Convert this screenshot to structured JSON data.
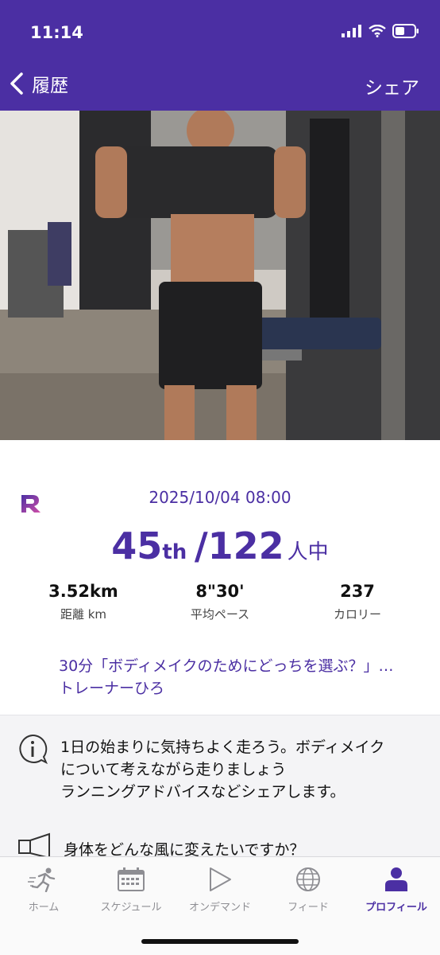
{
  "status": {
    "time": "11:14"
  },
  "nav": {
    "back_label": "履歴",
    "share_label": "シェア"
  },
  "photo": {
    "description_icon": "runner-photo"
  },
  "session": {
    "date": "2025/10/04 08:00",
    "rank": "45",
    "rank_suffix": "th",
    "total": "/122",
    "total_unit": "人中",
    "stats": [
      {
        "value": "3.52km",
        "label": "距離 km"
      },
      {
        "value": "8\"30'",
        "label": "平均ペース"
      },
      {
        "value": "237",
        "label": "カロリー"
      }
    ],
    "program_line1": "30分「ボディメイクのためにどっちを選ぶ？」…",
    "program_line2": "トレーナーひろ"
  },
  "description": {
    "line1": "1日の始まりに気持ちよく走ろう。ボディメイク",
    "line2": "について考えながら走りましょう",
    "line3": "ランニングアドバイスなどシェアします。",
    "question": "身体をどんな風に変えたいですか？"
  },
  "tabs": [
    {
      "label": "ホーム",
      "icon": "runner-icon"
    },
    {
      "label": "スケジュール",
      "icon": "calendar-icon"
    },
    {
      "label": "オンデマンド",
      "icon": "play-icon"
    },
    {
      "label": "フィード",
      "icon": "globe-icon"
    },
    {
      "label": "プロフィール",
      "icon": "person-icon"
    }
  ],
  "colors": {
    "brand": "#4b2fa3",
    "tab_inactive": "#8e8e93"
  }
}
